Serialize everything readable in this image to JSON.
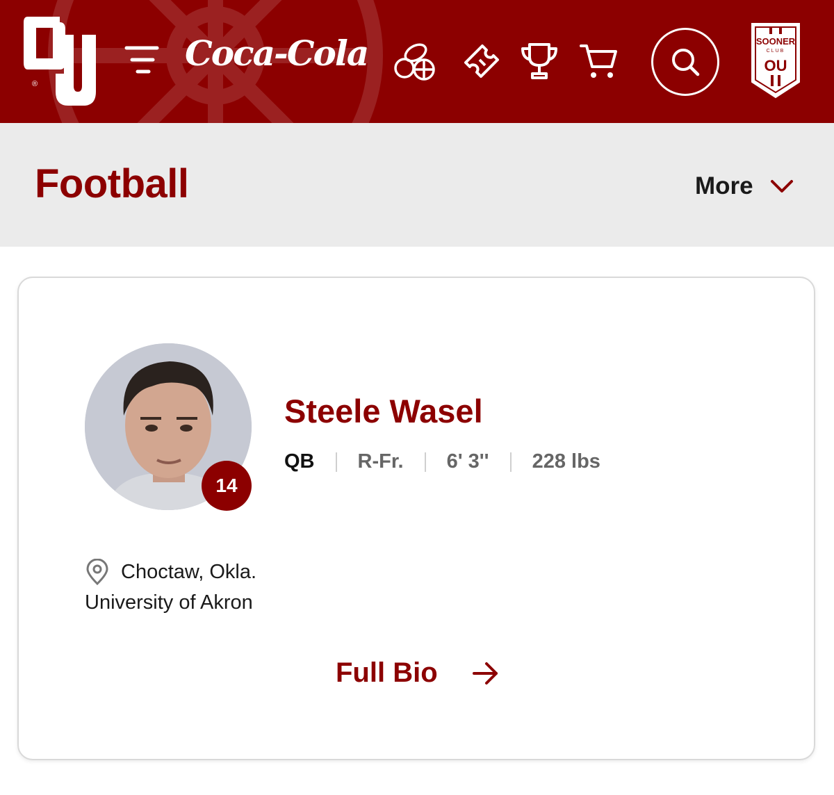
{
  "header": {
    "logo": "OU",
    "logo_mark": "®",
    "sponsor": "Coca-Cola",
    "icons": [
      "menu-icon",
      "sports-balls-icon",
      "ticket-icon",
      "trophy-icon",
      "cart-icon",
      "search-icon"
    ],
    "club_badge": {
      "line1": "SOONER",
      "line2": "CLUB",
      "mark": "OU"
    },
    "brand_color": "#8c0000"
  },
  "page": {
    "title": "Football",
    "more_label": "More"
  },
  "player": {
    "name": "Steele Wasel",
    "number": "14",
    "position": "QB",
    "class": "R-Fr.",
    "height": "6' 3''",
    "weight": "228 lbs",
    "hometown": "Choctaw, Okla.",
    "previous_school": "University of Akron",
    "bio_link_label": "Full Bio"
  }
}
